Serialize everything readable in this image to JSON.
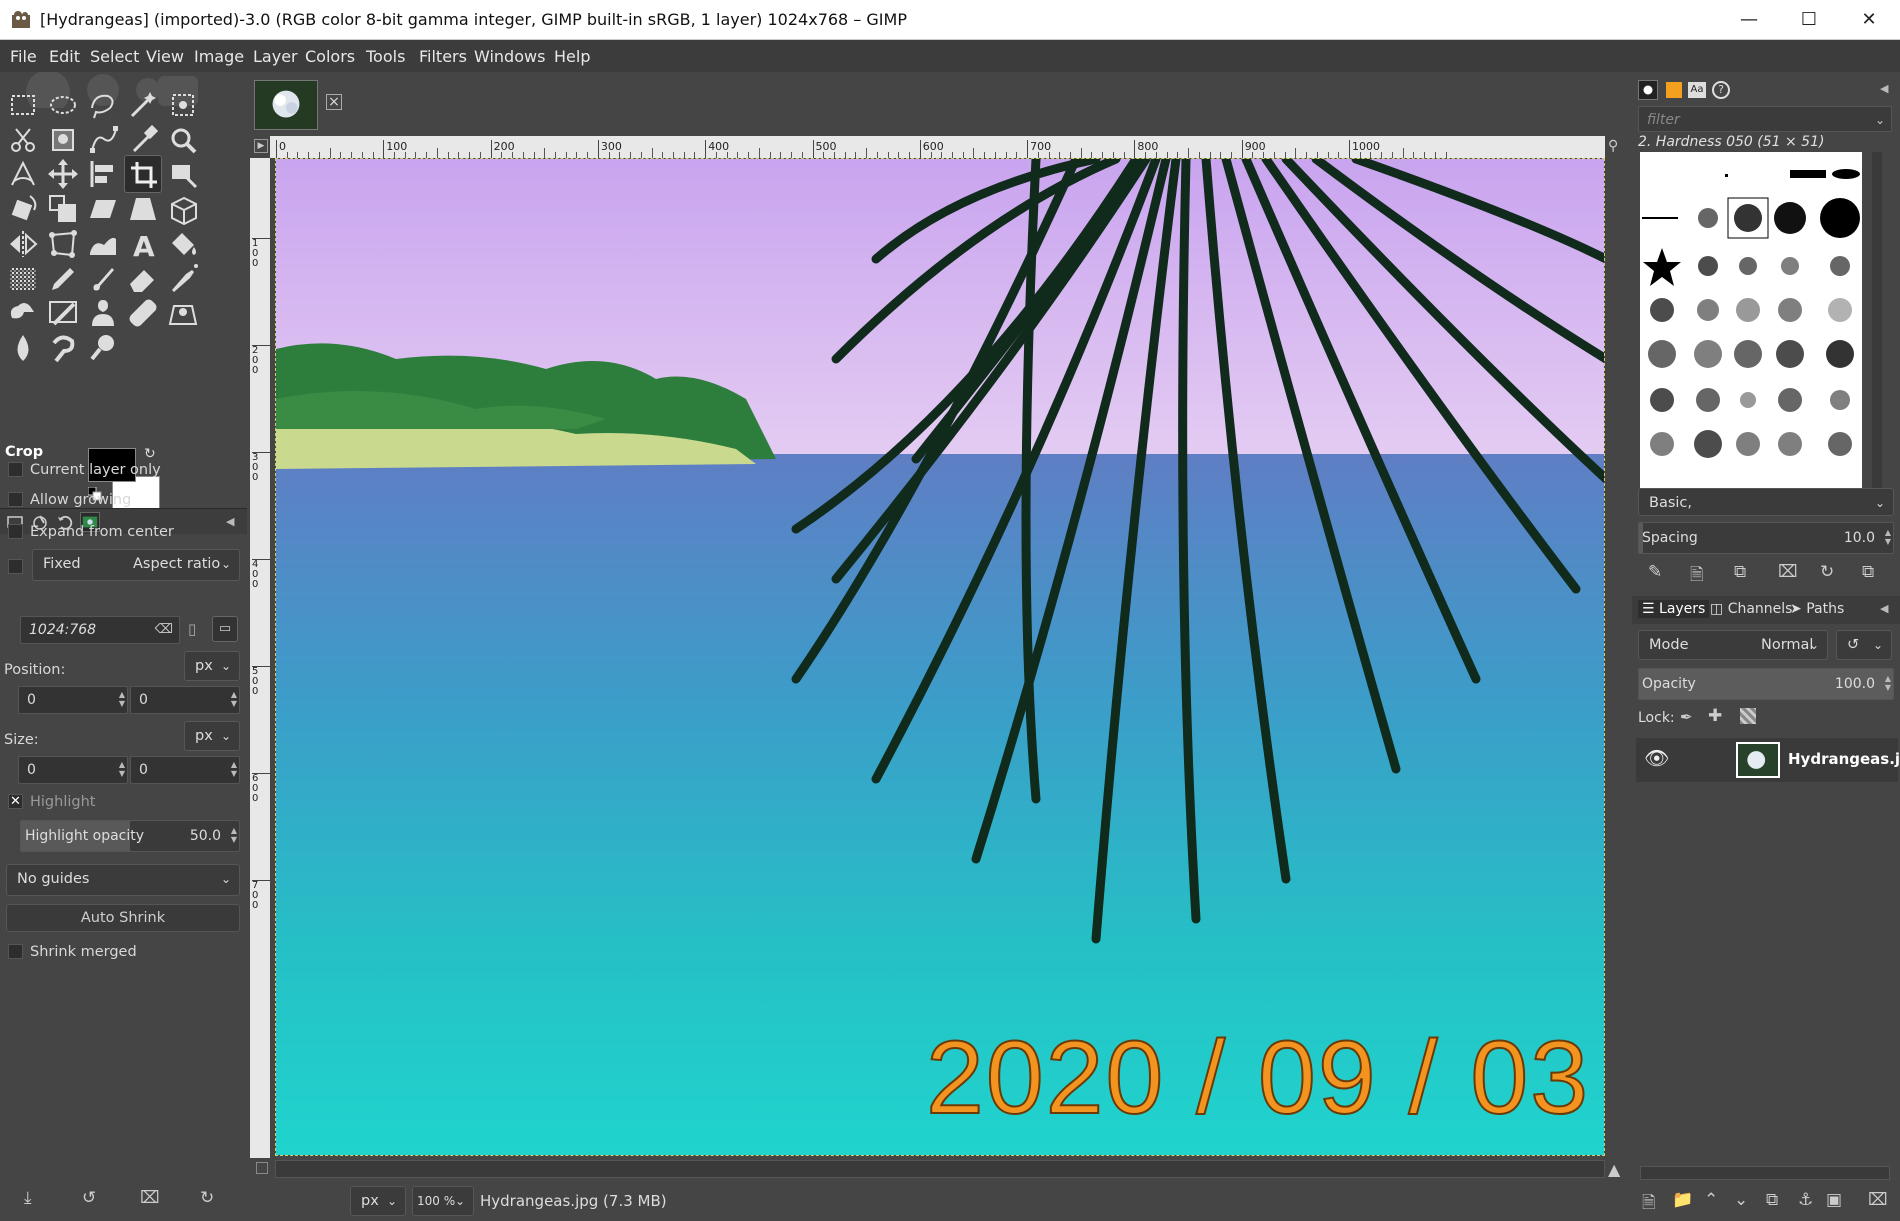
{
  "window": {
    "title": "[Hydrangeas] (imported)-3.0 (RGB color 8-bit gamma integer, GIMP built-in sRGB, 1 layer) 1024x768 – GIMP",
    "controls": {
      "minimize": "—",
      "maximize": "☐",
      "close": "✕"
    }
  },
  "menu": [
    "File",
    "Edit",
    "Select",
    "View",
    "Image",
    "Layer",
    "Colors",
    "Tools",
    "Filters",
    "Windows",
    "Help"
  ],
  "toolbox": {
    "icons": [
      "rect-select-icon",
      "ellipse-select-icon",
      "free-select-icon",
      "fuzzy-select-icon",
      "select-by-color-icon",
      "scissors-select-icon",
      "foreground-select-icon",
      "paths-icon",
      "color-picker-icon",
      "zoom-icon",
      "measure-icon",
      "move-icon",
      "align-icon",
      "crop-icon",
      "unified-transform-icon",
      "rotate-icon",
      "scale-icon",
      "shear-icon",
      "perspective-icon",
      "3d-transform-icon",
      "flip-icon",
      "cage-transform-icon",
      "warp-transform-icon",
      "text-icon",
      "bucket-fill-icon",
      "blend-icon",
      "pencil-icon",
      "paintbrush-icon",
      "eraser-icon",
      "airbrush-icon",
      "ink-icon",
      "mypaint-brush-icon",
      "clone-icon",
      "heal-icon",
      "perspective-clone-icon",
      "blur-icon",
      "smudge-icon",
      "dodge-burn-icon"
    ],
    "selected": "crop-icon",
    "fg_color": "#000000",
    "bg_color": "#ffffff"
  },
  "tool_options": {
    "title": "Crop",
    "current_layer_only": "Current layer only",
    "allow_growing": "Allow growing",
    "expand_from_center": "Expand from center",
    "fixed_label": "Fixed",
    "fixed_mode": "Aspect ratio",
    "ratio_value": "1024:768",
    "position_label": "Position:",
    "position_unit": "px",
    "position_x": "0",
    "position_y": "0",
    "size_label": "Size:",
    "size_unit": "px",
    "size_w": "0",
    "size_h": "0",
    "highlight": "Highlight",
    "highlight_opacity_label": "Highlight opacity",
    "highlight_opacity_value": "50.0",
    "highlight_opacity_fraction": 0.5,
    "guides": "No guides",
    "auto_shrink": "Auto Shrink",
    "shrink_merged": "Shrink merged"
  },
  "canvas": {
    "ruler_ticks": [
      "0",
      "100",
      "200",
      "300",
      "400",
      "500",
      "600",
      "700",
      "800",
      "900",
      "1000"
    ],
    "vruler_ticks": [
      "1\n0\n0",
      "2\n0\n0",
      "3\n0\n0",
      "4\n0\n0",
      "5\n0\n0",
      "6\n0\n0",
      "7\n0\n0"
    ],
    "date_stamp": "2020 / 09 / 03"
  },
  "status": {
    "unit": "px",
    "zoom": "100 %",
    "file": "Hydrangeas.jpg (7.3 MB)"
  },
  "brushes": {
    "filter_placeholder": "filter",
    "current": "2. Hardness 050 (51 × 51)",
    "preset": "Basic,",
    "spacing_label": "Spacing",
    "spacing_value": "10.0"
  },
  "layers": {
    "tabs": [
      "Layers",
      "Channels",
      "Paths"
    ],
    "mode_label": "Mode",
    "mode_value": "Normal",
    "opacity_label": "Opacity",
    "opacity_value": "100.0",
    "lock_label": "Lock:",
    "layer_name": "Hydrangeas.jp"
  }
}
